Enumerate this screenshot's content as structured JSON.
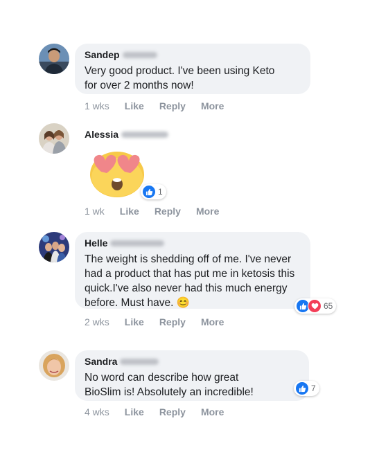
{
  "comments": [
    {
      "author": "Sandep",
      "text_lines": [
        "Very good product. I've been using Keto",
        "for over 2 months now!"
      ],
      "time": "1 wks",
      "like": "Like",
      "reply": "Reply",
      "more": "More"
    },
    {
      "author": "Alessia",
      "sticker": "heart-eyes-emoji",
      "reactions": "1",
      "time": "1 wk",
      "like": "Like",
      "reply": "Reply",
      "more": "More"
    },
    {
      "author": "Helle",
      "text_lines": [
        "The weight is shedding off of me. I've never",
        "had a product that has put me in ketosis this",
        "quick.I've also never had this much energy",
        "before. Must have. 😊"
      ],
      "reactions": "65",
      "time": "2 wks",
      "like": "Like",
      "reply": "Reply",
      "more": "More"
    },
    {
      "author": "Sandra",
      "text_lines": [
        "No word can describe how great",
        "BioSlim is! Absolutely an incredible!"
      ],
      "reactions": "7",
      "time": "4 wks",
      "like": "Like",
      "reply": "Reply",
      "more": "More"
    }
  ],
  "colors": {
    "bubble": "#f0f2f5",
    "like_blue": "#1877f2",
    "love_red": "#f33e58",
    "meta_gray": "#8d949e"
  }
}
